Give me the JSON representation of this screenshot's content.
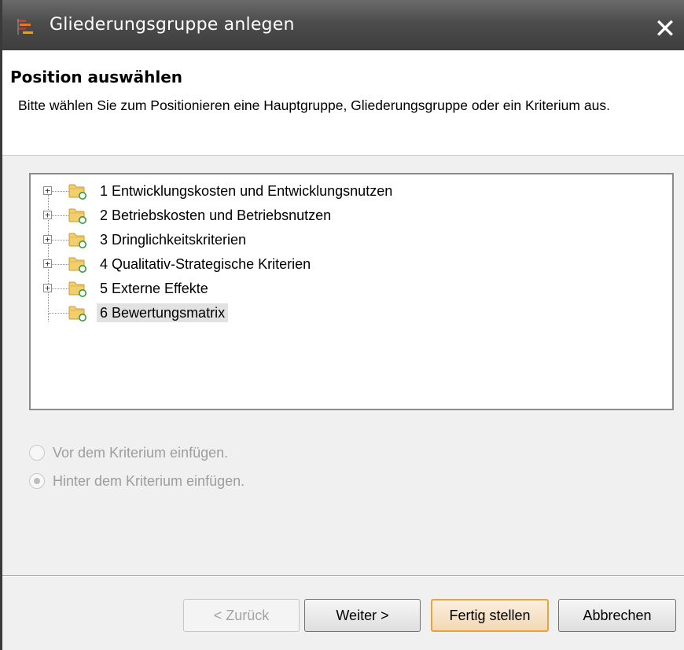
{
  "window": {
    "title": "Gliederungsgruppe anlegen",
    "close_label": "✕"
  },
  "header": {
    "title": "Position auswählen",
    "description": "Bitte wählen Sie zum Positionieren eine Hauptgruppe, Gliederungsgruppe oder ein Kriterium aus."
  },
  "tree": {
    "items": [
      {
        "label": "1 Entwicklungskosten und Entwicklungsnutzen",
        "expandable": true,
        "selected": false
      },
      {
        "label": "2 Betriebskosten und Betriebsnutzen",
        "expandable": true,
        "selected": false
      },
      {
        "label": "3 Dringlichkeitskriterien",
        "expandable": true,
        "selected": false
      },
      {
        "label": "4 Qualitativ-Strategische Kriterien",
        "expandable": true,
        "selected": false
      },
      {
        "label": "5 Externe Effekte",
        "expandable": true,
        "selected": false
      },
      {
        "label": "6 Bewertungsmatrix",
        "expandable": false,
        "selected": true
      }
    ],
    "expander_symbol": "+"
  },
  "options": {
    "before_label": "Vor dem Kriterium einfügen.",
    "after_label": "Hinter dem Kriterium einfügen.",
    "selected": "after",
    "enabled": false
  },
  "buttons": {
    "back_label": "< Zurück",
    "next_label": "Weiter >",
    "finish_label": "Fertig stellen",
    "cancel_label": "Abbrechen"
  },
  "colors": {
    "title_bar": "#4c4c4c",
    "selection": "#e2e2e2",
    "default_button_border": "#e8a33b",
    "folder": "#f5d67a"
  }
}
